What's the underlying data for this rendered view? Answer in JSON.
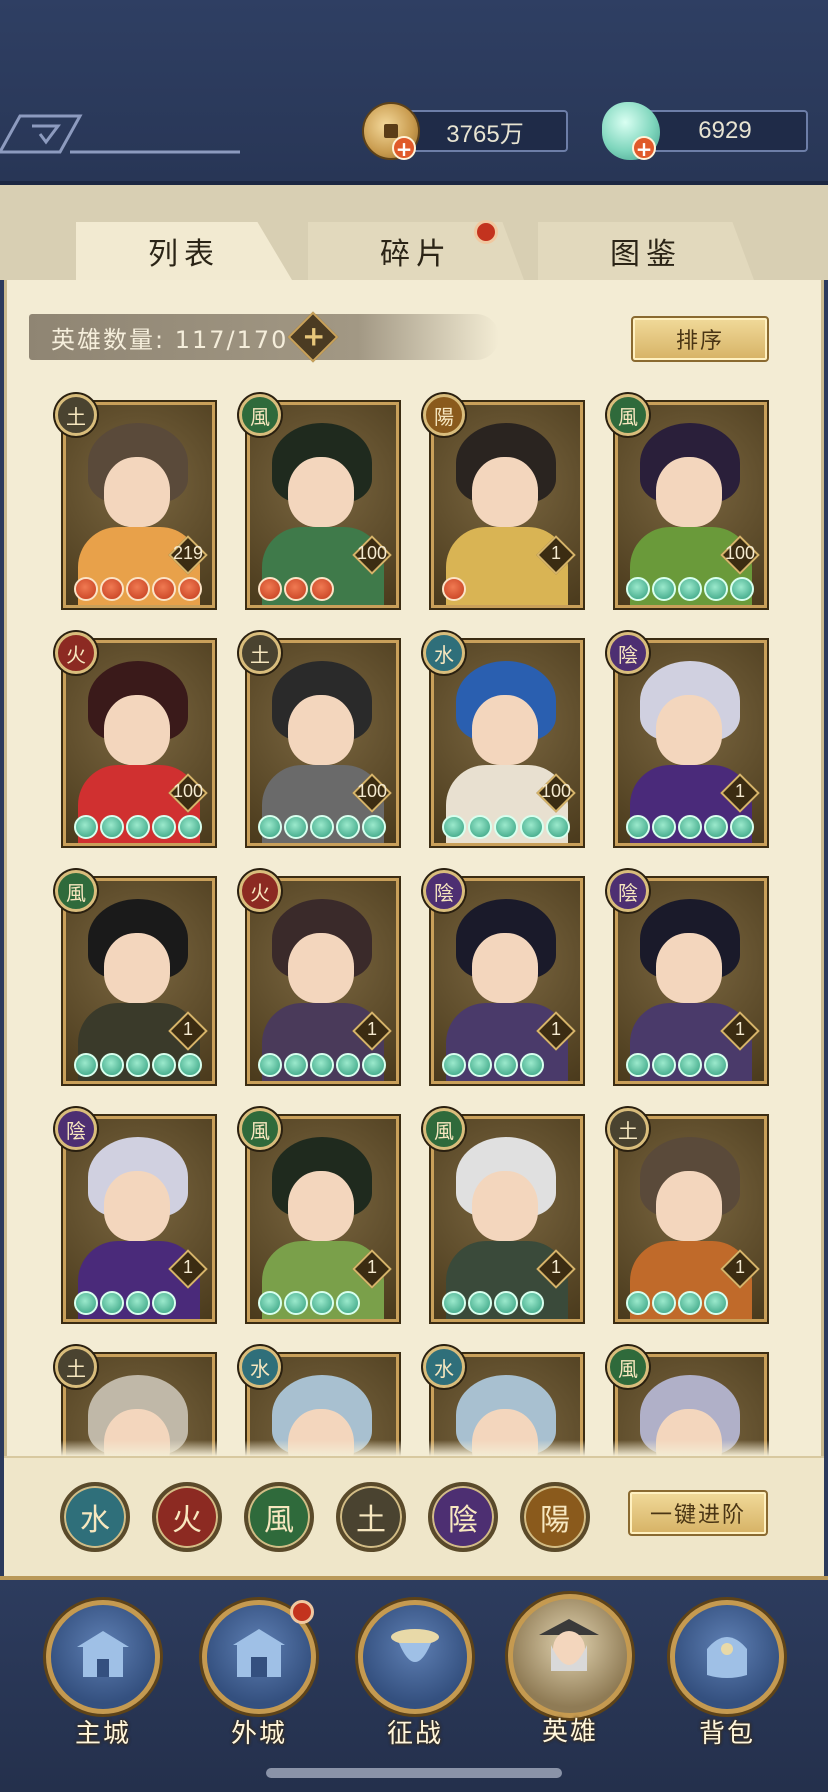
{
  "currency": {
    "coins": "3765万",
    "shells": "6929"
  },
  "tabs": [
    {
      "label": "列表"
    },
    {
      "label": "碎片"
    },
    {
      "label": "图鉴"
    }
  ],
  "hero_count": "英雄数量: 117/170",
  "sort_label": "排序",
  "advance_label": "一键进阶",
  "heroes": [
    {
      "element": "土",
      "level": "219",
      "stars": 5,
      "star_color": "red"
    },
    {
      "element": "風",
      "level": "100",
      "stars": 3,
      "star_color": "red"
    },
    {
      "element": "陽",
      "level": "1",
      "stars": 1,
      "star_color": "red"
    },
    {
      "element": "風",
      "level": "100",
      "stars": 5,
      "star_color": "jade"
    },
    {
      "element": "火",
      "level": "100",
      "stars": 5,
      "star_color": "jade"
    },
    {
      "element": "土",
      "level": "100",
      "stars": 5,
      "star_color": "jade"
    },
    {
      "element": "水",
      "level": "100",
      "stars": 5,
      "star_color": "jade"
    },
    {
      "element": "陰",
      "level": "1",
      "stars": 5,
      "star_color": "jade"
    },
    {
      "element": "風",
      "level": "1",
      "stars": 5,
      "star_color": "jade"
    },
    {
      "element": "火",
      "level": "1",
      "stars": 5,
      "star_color": "jade"
    },
    {
      "element": "陰",
      "level": "1",
      "stars": 4,
      "star_color": "jade"
    },
    {
      "element": "陰",
      "level": "1",
      "stars": 4,
      "star_color": "jade"
    },
    {
      "element": "陰",
      "level": "1",
      "stars": 4,
      "star_color": "jade"
    },
    {
      "element": "風",
      "level": "1",
      "stars": 4,
      "star_color": "jade"
    },
    {
      "element": "風",
      "level": "1",
      "stars": 4,
      "star_color": "jade"
    },
    {
      "element": "土",
      "level": "1",
      "stars": 4,
      "star_color": "jade"
    },
    {
      "element": "土",
      "level": "",
      "stars": 0,
      "star_color": "jade"
    },
    {
      "element": "水",
      "level": "",
      "stars": 0,
      "star_color": "jade"
    },
    {
      "element": "水",
      "level": "",
      "stars": 0,
      "star_color": "jade"
    },
    {
      "element": "風",
      "level": "",
      "stars": 0,
      "star_color": "jade"
    }
  ],
  "element_colors": {
    "水": "#2f6f7a",
    "火": "#8c2a22",
    "風": "#2f6a3b",
    "土": "#4a4330",
    "陰": "#4d2f72",
    "陽": "#8a5a1c"
  },
  "filters": [
    {
      "label": "水"
    },
    {
      "label": "火"
    },
    {
      "label": "風"
    },
    {
      "label": "土"
    },
    {
      "label": "陰"
    },
    {
      "label": "陽"
    }
  ],
  "nav": [
    {
      "label": "主城",
      "icon": "main-city-icon"
    },
    {
      "label": "外城",
      "icon": "outer-city-icon"
    },
    {
      "label": "征战",
      "icon": "campaign-icon"
    },
    {
      "label": "英雄",
      "icon": "hero-icon"
    },
    {
      "label": "背包",
      "icon": "backpack-icon"
    }
  ]
}
